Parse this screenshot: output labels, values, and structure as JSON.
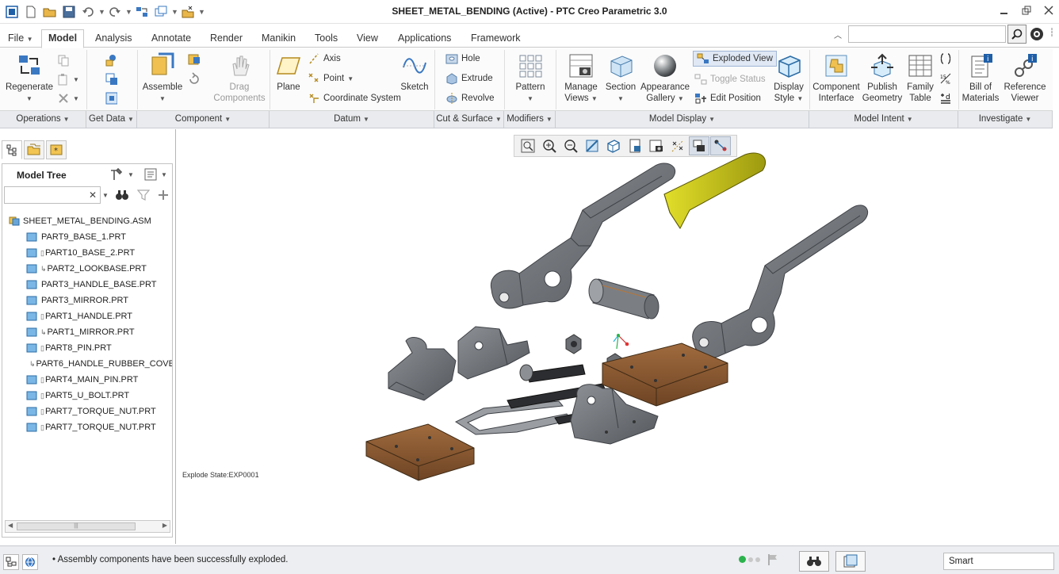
{
  "window": {
    "title": "SHEET_METAL_BENDING (Active) - PTC Creo Parametric 3.0"
  },
  "tabs": [
    {
      "label": "File",
      "name": "file"
    },
    {
      "label": "Model",
      "name": "model"
    },
    {
      "label": "Analysis",
      "name": "analysis"
    },
    {
      "label": "Annotate",
      "name": "annotate"
    },
    {
      "label": "Render",
      "name": "render"
    },
    {
      "label": "Manikin",
      "name": "manikin"
    },
    {
      "label": "Tools",
      "name": "tools"
    },
    {
      "label": "View",
      "name": "view"
    },
    {
      "label": "Applications",
      "name": "applications"
    },
    {
      "label": "Framework",
      "name": "framework"
    }
  ],
  "ribbon": {
    "regenerate": "Regenerate",
    "assemble": "Assemble",
    "drag_components": [
      "Drag",
      "Components"
    ],
    "plane": "Plane",
    "axis": "Axis",
    "point": "Point",
    "coordinate_system": "Coordinate System",
    "sketch": "Sketch",
    "hole": "Hole",
    "extrude": "Extrude",
    "revolve": "Revolve",
    "pattern": "Pattern",
    "manage_views": [
      "Manage",
      "Views"
    ],
    "section": "Section",
    "appearance_gallery": [
      "Appearance",
      "Gallery"
    ],
    "exploded_view": "Exploded View",
    "toggle_status": "Toggle Status",
    "edit_position": "Edit Position",
    "display_style": [
      "Display",
      "Style"
    ],
    "component_interface": [
      "Component",
      "Interface"
    ],
    "publish_geometry": [
      "Publish",
      "Geometry"
    ],
    "family_table": [
      "Family",
      "Table"
    ],
    "bill_of_materials": [
      "Bill of",
      "Materials"
    ],
    "reference_viewer": [
      "Reference",
      "Viewer"
    ]
  },
  "groups": [
    {
      "label": "Operations"
    },
    {
      "label": "Get Data"
    },
    {
      "label": "Component"
    },
    {
      "label": "Datum"
    },
    {
      "label": "Cut & Surface"
    },
    {
      "label": "Modifiers"
    },
    {
      "label": "Model Display"
    },
    {
      "label": "Model Intent"
    },
    {
      "label": "Investigate"
    }
  ],
  "model_tree": {
    "title": "Model Tree",
    "root": "SHEET_METAL_BENDING.ASM",
    "items": [
      {
        "label": "PART9_BASE_1.PRT",
        "marker": ""
      },
      {
        "label": "PART10_BASE_2.PRT",
        "marker": "▯"
      },
      {
        "label": "PART2_LOOKBASE.PRT",
        "marker": "↳"
      },
      {
        "label": "PART3_HANDLE_BASE.PRT",
        "marker": ""
      },
      {
        "label": "PART3_MIRROR.PRT",
        "marker": ""
      },
      {
        "label": "PART1_HANDLE.PRT",
        "marker": "▯"
      },
      {
        "label": "PART1_MIRROR.PRT",
        "marker": "↳"
      },
      {
        "label": "PART8_PIN.PRT",
        "marker": "▯"
      },
      {
        "label": "PART6_HANDLE_RUBBER_COVE",
        "marker": "↳"
      },
      {
        "label": "PART4_MAIN_PIN.PRT",
        "marker": "▯"
      },
      {
        "label": "PART5_U_BOLT.PRT",
        "marker": "▯"
      },
      {
        "label": "PART7_TORQUE_NUT.PRT",
        "marker": "▯"
      },
      {
        "label": "PART7_TORQUE_NUT.PRT",
        "marker": "▯"
      }
    ],
    "scroll_thumb": "|||"
  },
  "graphics": {
    "explode_state": "Explode State:EXP0001"
  },
  "status": {
    "message": "Assembly components have been successfully exploded.",
    "filter": "Smart"
  },
  "colors": {
    "steel": "#6f7378",
    "wood": "#8b5a34",
    "rubber": "#d6d21a",
    "accent": "#3a78c2"
  }
}
